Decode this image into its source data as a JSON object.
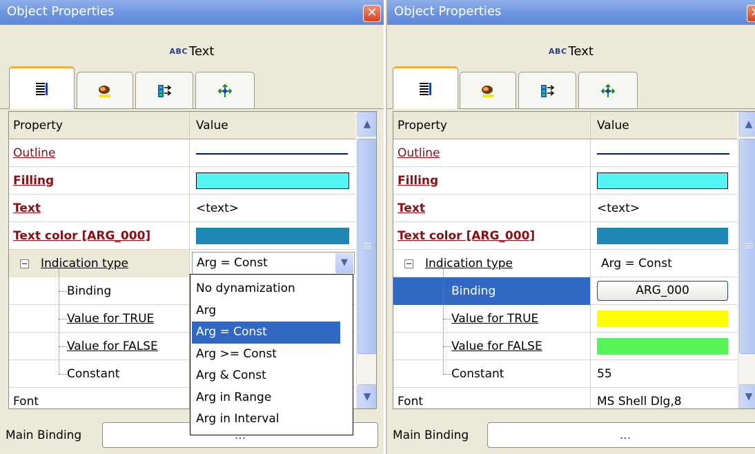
{
  "left": {
    "title": "Object Properties",
    "object_type_badge": "ABC",
    "object_name": "Text",
    "header": {
      "property": "Property",
      "value": "Value"
    },
    "props": {
      "outline": "Outline",
      "filling": "Filling",
      "text": "Text",
      "text_value": "<text>",
      "text_color": "Text color [ARG_000]",
      "indication_type": "Indication type",
      "indication_value": "Arg = Const",
      "binding": "Binding",
      "value_true": "Value for TRUE",
      "value_false": "Value for FALSE",
      "constant": "Constant",
      "font": "Font"
    },
    "dropdown_options": [
      "No dynamization",
      "Arg",
      "Arg = Const",
      "Arg >= Const",
      "Arg & Const",
      "Arg in Range",
      "Arg in Interval"
    ],
    "selected_option": "Arg = Const",
    "main_binding_label": "Main Binding",
    "main_binding_value": "..."
  },
  "right": {
    "title": "Object Properties",
    "object_type_badge": "ABC",
    "object_name": "Text",
    "header": {
      "property": "Property",
      "value": "Value"
    },
    "props": {
      "outline": "Outline",
      "filling": "Filling",
      "text": "Text",
      "text_value": "<text>",
      "text_color": "Text color [ARG_000]",
      "indication_type": "Indication type",
      "indication_value": "Arg = Const",
      "binding": "Binding",
      "binding_value": "ARG_000",
      "value_true": "Value for TRUE",
      "value_false": "Value for FALSE",
      "constant": "Constant",
      "constant_value": "55",
      "font": "Font",
      "font_value": "MS Shell Dlg,8"
    },
    "main_binding_label": "Main Binding",
    "main_binding_value": "..."
  },
  "icons": {
    "close": "close-icon",
    "tab1": "property-list-icon",
    "tab2": "dynamics-icon",
    "tab3": "bindings-icon",
    "tab4": "actions-icon"
  },
  "colors": {
    "outline": "#0f1466",
    "filling": "#55f4f4",
    "text_color": "#1e88b4",
    "value_true": "#ffff00",
    "value_false": "#55f355",
    "selection": "#3168c4",
    "link": "#8a0e12"
  }
}
